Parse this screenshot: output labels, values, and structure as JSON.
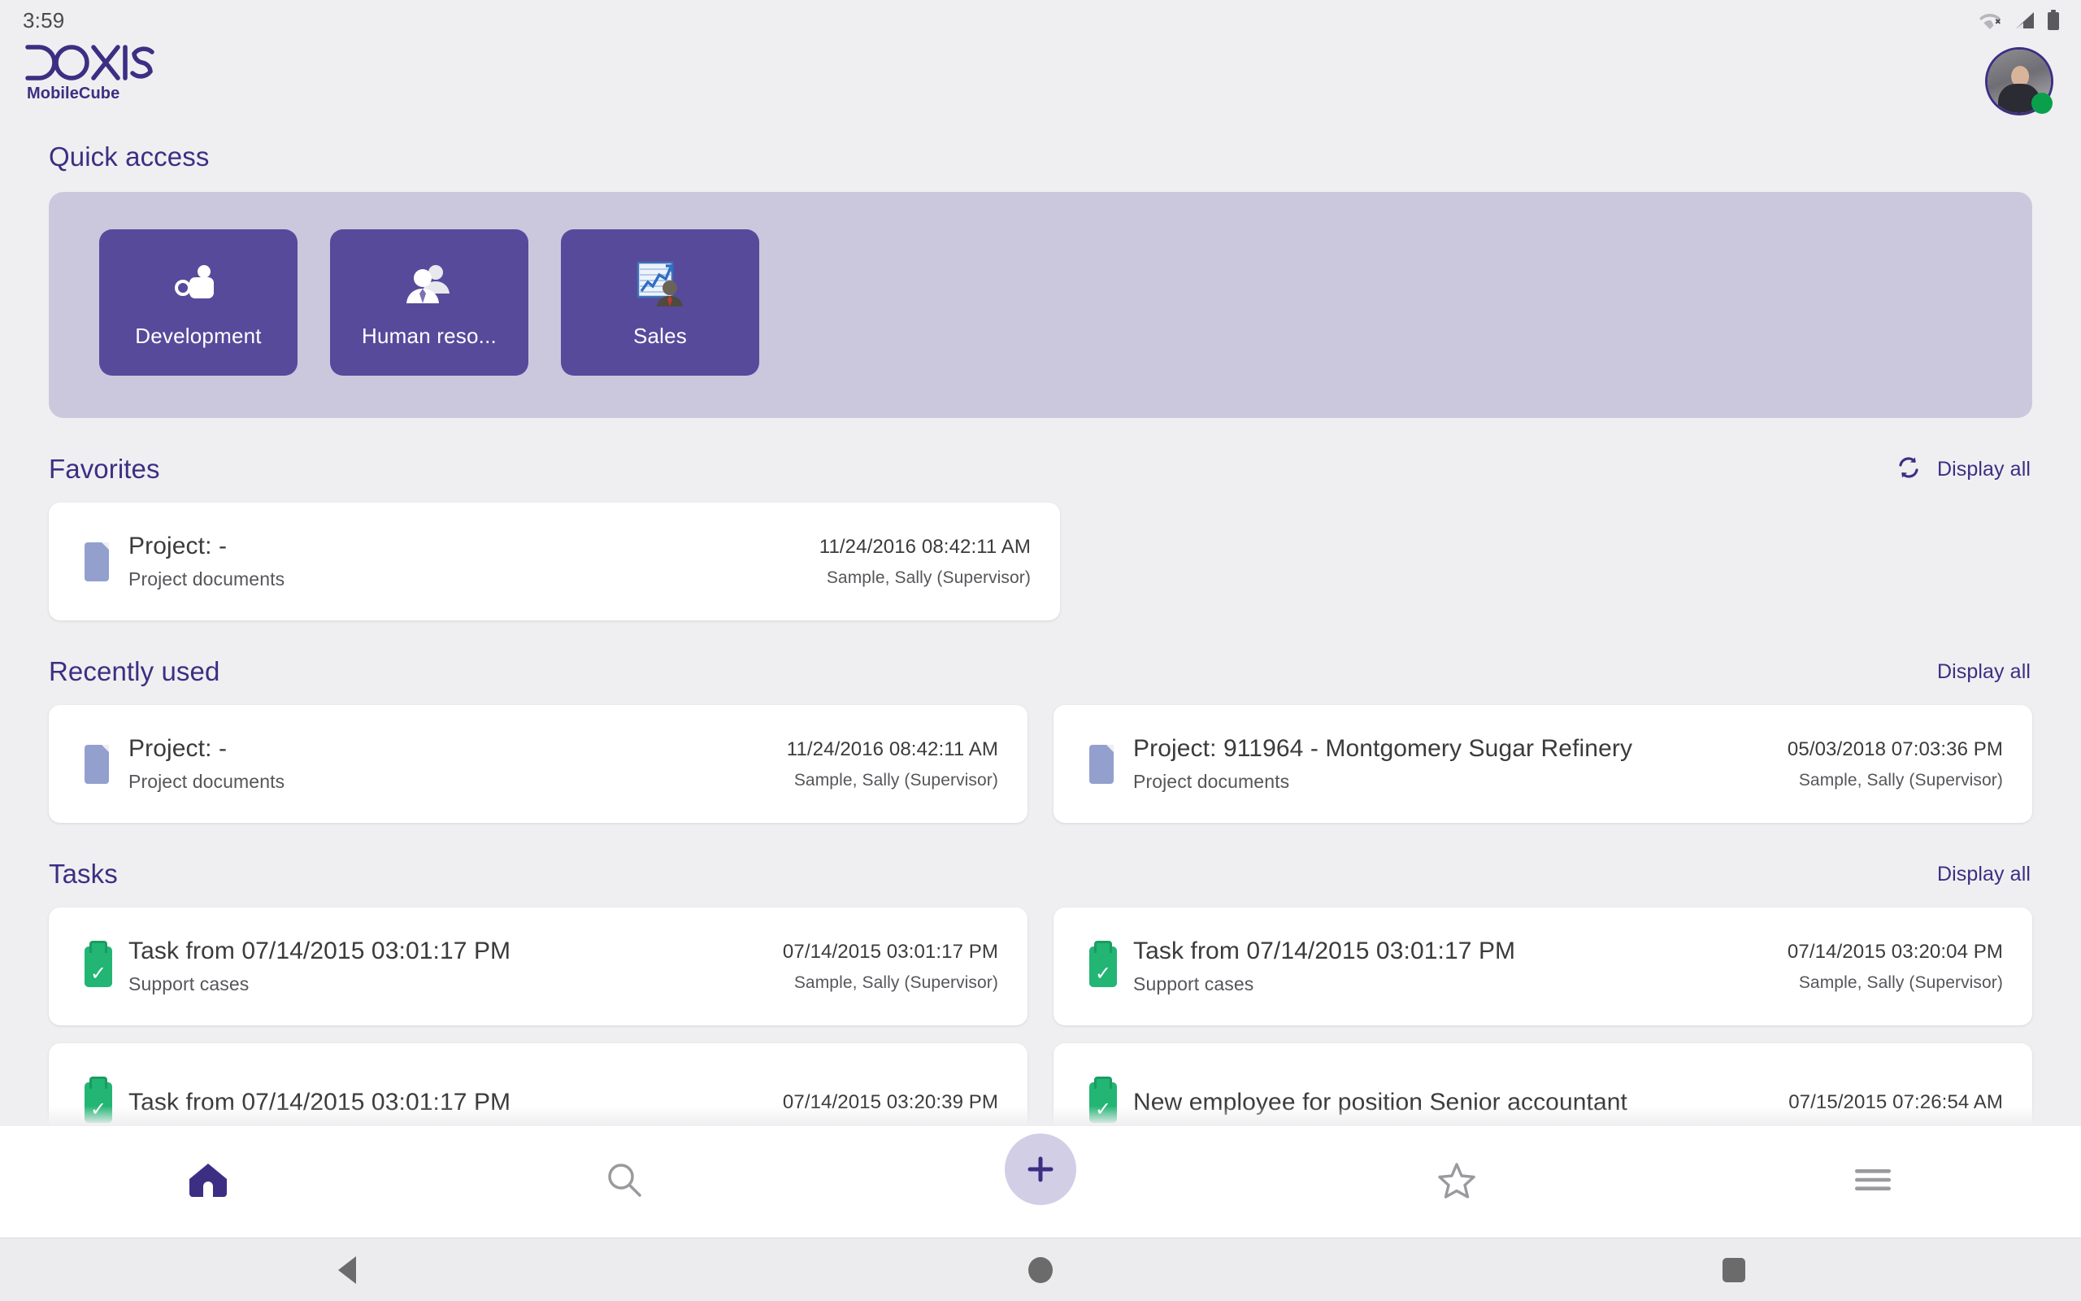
{
  "status_bar": {
    "time": "3:59",
    "icons": [
      "wifi-off-icon",
      "cellular-signal-icon",
      "battery-icon"
    ]
  },
  "header": {
    "logo_text": "DOXIS",
    "logo_subtitle": "MobileCube",
    "avatar_name": "avatar",
    "presence": "online"
  },
  "quick_access": {
    "title": "Quick access",
    "tiles": [
      {
        "label": "Development",
        "icon": "projector-icon"
      },
      {
        "label": "Human reso...",
        "icon": "people-icon"
      },
      {
        "label": "Sales",
        "icon": "chart-person-icon"
      }
    ]
  },
  "favorites": {
    "title": "Favorites",
    "refresh_icon": "refresh-icon",
    "display_all": "Display all",
    "items": [
      {
        "icon": "document-icon",
        "title": "Project:  -",
        "subtitle": "Project documents",
        "date": "11/24/2016 08:42:11 AM",
        "owner": "Sample, Sally (Supervisor)"
      }
    ]
  },
  "recently_used": {
    "title": "Recently used",
    "display_all": "Display all",
    "items": [
      {
        "icon": "document-icon",
        "title": "Project:  -",
        "subtitle": "Project documents",
        "date": "11/24/2016 08:42:11 AM",
        "owner": "Sample, Sally (Supervisor)"
      },
      {
        "icon": "document-icon",
        "title": "Project: 911964 - Montgomery Sugar Refinery",
        "subtitle": "Project documents",
        "date": "05/03/2018 07:03:36 PM",
        "owner": "Sample, Sally (Supervisor)"
      }
    ]
  },
  "tasks": {
    "title": "Tasks",
    "display_all": "Display all",
    "items": [
      {
        "icon": "task-icon",
        "title": "Task from 07/14/2015 03:01:17 PM",
        "subtitle": "Support cases",
        "date": "07/14/2015 03:01:17 PM",
        "owner": "Sample, Sally (Supervisor)"
      },
      {
        "icon": "task-icon",
        "title": "Task from 07/14/2015 03:01:17 PM",
        "subtitle": "Support cases",
        "date": "07/14/2015 03:20:04 PM",
        "owner": "Sample, Sally (Supervisor)"
      },
      {
        "icon": "task-icon",
        "title": "Task from 07/14/2015 03:01:17 PM",
        "subtitle": "",
        "date": "07/14/2015 03:20:39 PM",
        "owner": ""
      },
      {
        "icon": "task-icon",
        "title": "New employee for position Senior accountant",
        "subtitle": "",
        "date": "07/15/2015 07:26:54 AM",
        "owner": ""
      }
    ]
  },
  "bottom_nav": {
    "items": [
      {
        "name": "home",
        "icon": "home-icon",
        "active": true
      },
      {
        "name": "search",
        "icon": "search-icon",
        "active": false
      },
      {
        "name": "add",
        "icon": "plus-icon",
        "active": false
      },
      {
        "name": "favorites",
        "icon": "star-outline-icon",
        "active": false
      },
      {
        "name": "menu",
        "icon": "hamburger-menu-icon",
        "active": false
      }
    ]
  },
  "system_nav": {
    "back": "back-triangle-icon",
    "home": "home-circle-icon",
    "recents": "recents-square-icon"
  },
  "colors": {
    "brand_purple": "#3c2f83",
    "tile_purple": "#574a9b",
    "panel_lavender": "#cbc8dd",
    "page_bg": "#efeff1",
    "card_bg": "#ffffff",
    "task_green": "#22b573",
    "doc_blue": "#93a0ce",
    "presence_green": "#0aa04b"
  }
}
